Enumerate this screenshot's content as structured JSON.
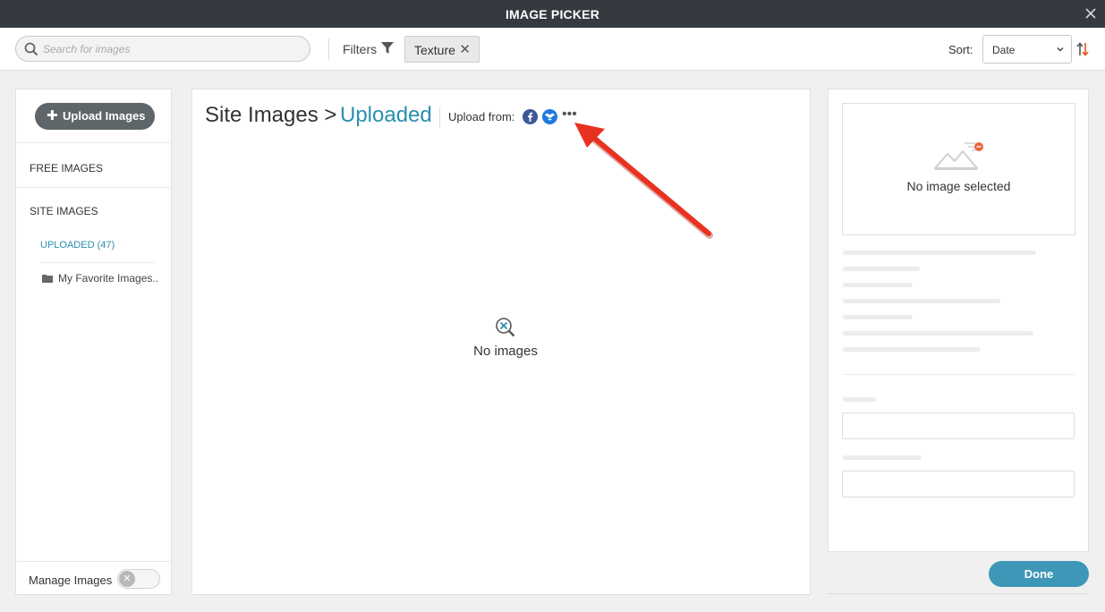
{
  "window": {
    "title": "IMAGE PICKER",
    "close_icon": "close-icon"
  },
  "toolbar": {
    "search_placeholder": "Search for images",
    "filters_label": "Filters",
    "active_filter": "Texture",
    "sort_label": "Sort:",
    "sort_value": "Date",
    "icons": [
      "search-icon",
      "filter-icon",
      "chevron-down-icon",
      "sort-direction-icon"
    ]
  },
  "sidebar": {
    "upload_button": "Upload Images",
    "free_images": "FREE IMAGES",
    "site_images": "SITE IMAGES",
    "uploaded": "UPLOADED (47)",
    "folder": "My Favorite Images..",
    "manage_label": "Manage Images",
    "manage_enabled": false
  },
  "main": {
    "breadcrumb_root": "Site Images >",
    "breadcrumb_current": "Uploaded",
    "upload_from": "Upload from:",
    "upload_sources": [
      "facebook-icon",
      "dropbox-icon"
    ],
    "more": "•••",
    "empty_text": "No images"
  },
  "details": {
    "empty_text": "No image selected"
  },
  "footer": {
    "done_label": "Done"
  },
  "colors": {
    "titlebar": "#343a3f",
    "accent": "#2a8fb0",
    "done_button": "#3f97b7",
    "annotation_arrow": "#e8321f"
  }
}
